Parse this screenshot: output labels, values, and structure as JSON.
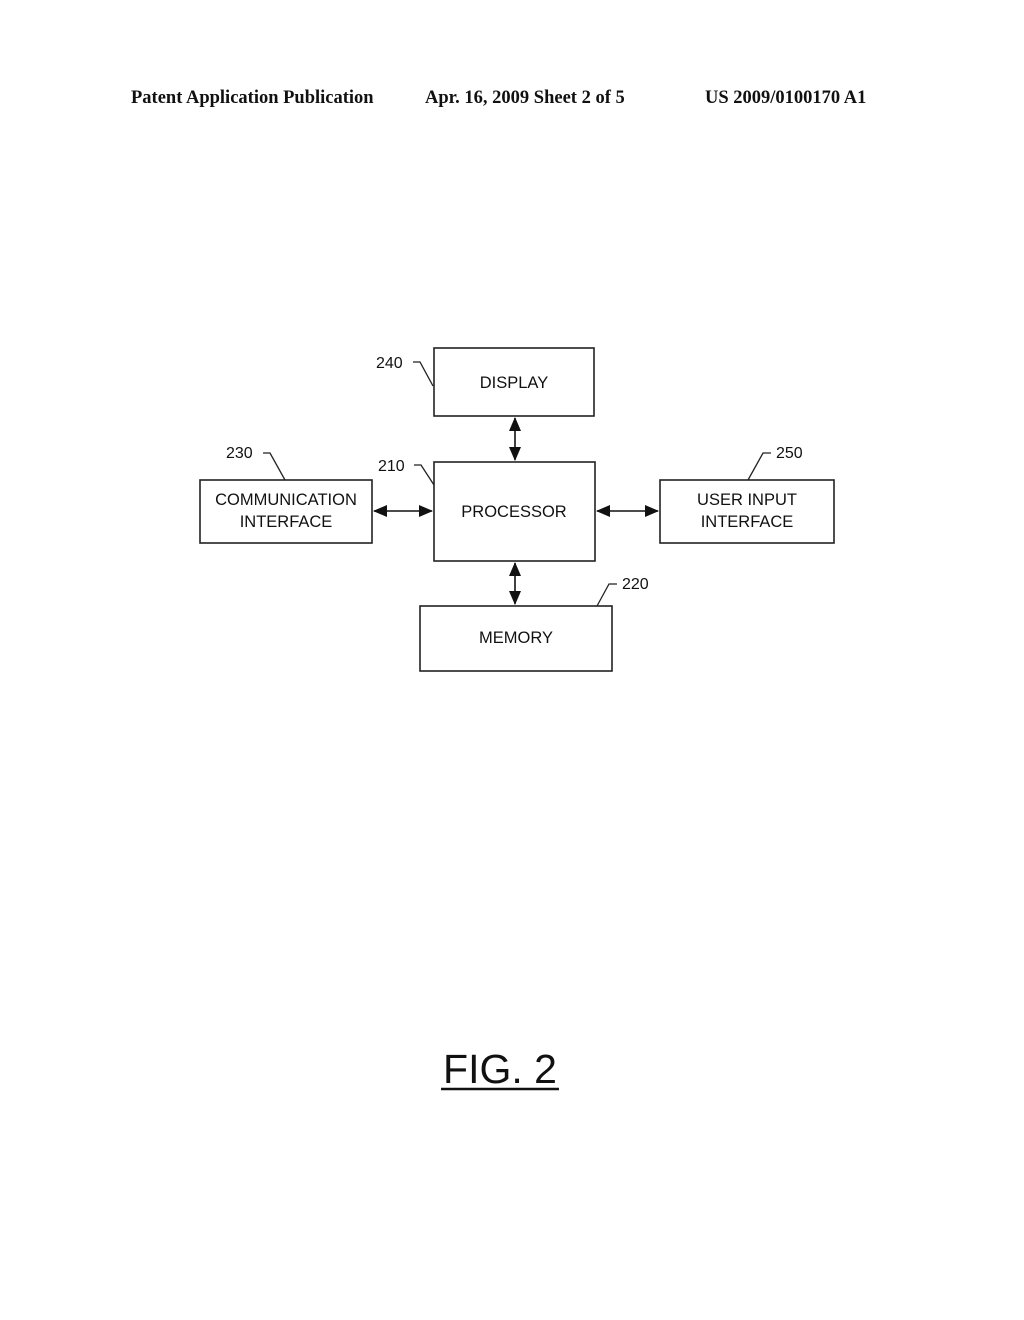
{
  "header": {
    "left": "Patent Application Publication",
    "center": "Apr. 16, 2009  Sheet 2 of 5",
    "right": "US 2009/0100170 A1"
  },
  "diagram": {
    "nodes": [
      {
        "id": "display",
        "label_lines": [
          "DISPLAY"
        ],
        "ref": "240"
      },
      {
        "id": "processor",
        "label_lines": [
          "PROCESSOR"
        ],
        "ref": "210"
      },
      {
        "id": "communication-interface",
        "label_lines": [
          "COMMUNICATION",
          "INTERFACE"
        ],
        "ref": "230"
      },
      {
        "id": "user-input-interface",
        "label_lines": [
          "USER INPUT",
          "INTERFACE"
        ],
        "ref": "250"
      },
      {
        "id": "memory",
        "label_lines": [
          "MEMORY"
        ],
        "ref": "220"
      }
    ],
    "edges": [
      {
        "from": "processor",
        "to": "display",
        "bidirectional": true
      },
      {
        "from": "processor",
        "to": "communication-interface",
        "bidirectional": true
      },
      {
        "from": "processor",
        "to": "user-input-interface",
        "bidirectional": true
      },
      {
        "from": "processor",
        "to": "memory",
        "bidirectional": true
      }
    ],
    "figure_label": "FIG. 2"
  }
}
